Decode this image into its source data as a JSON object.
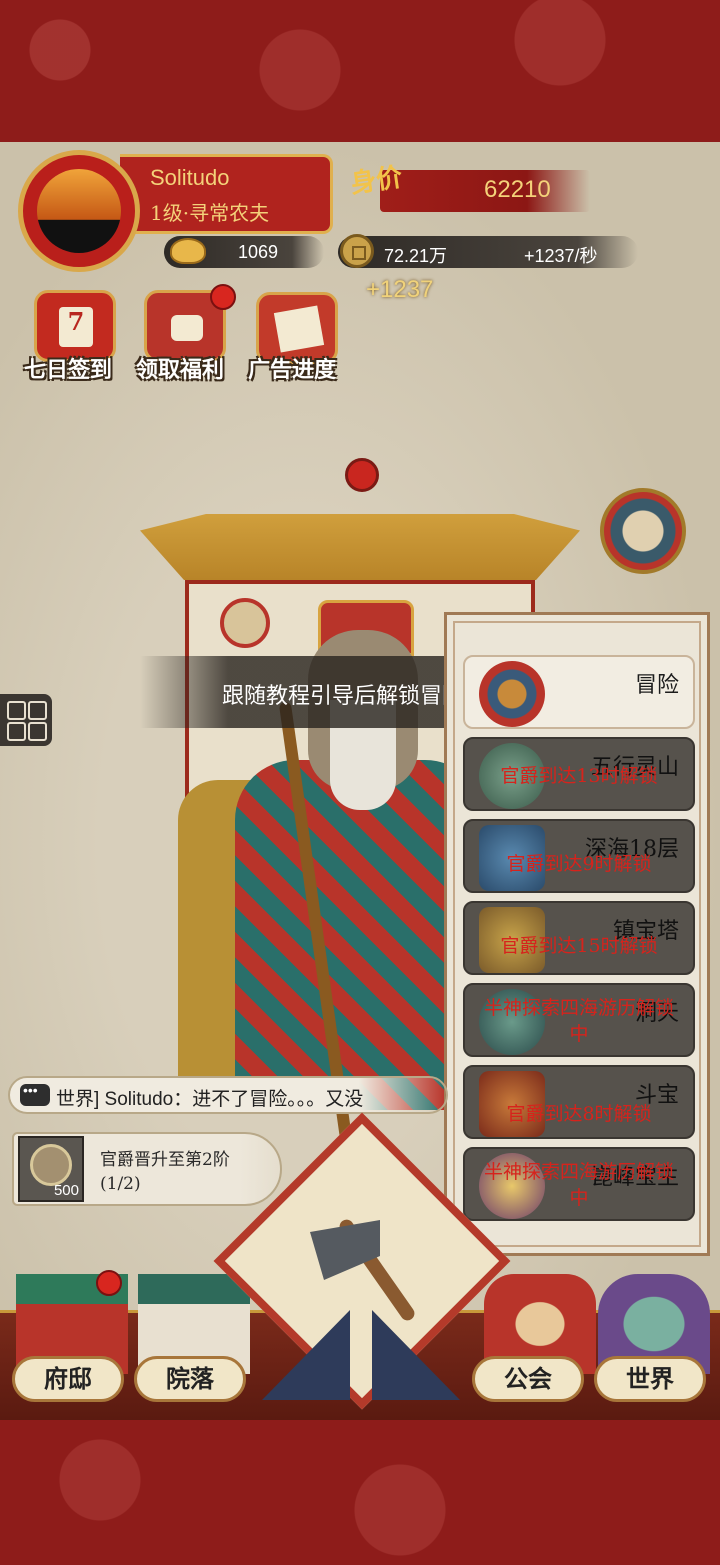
{
  "player": {
    "name": "Solitudo",
    "rank": "1级·寻常农夫",
    "worth_label": "身价",
    "worth": "62210"
  },
  "currency": {
    "ingot": "1069",
    "coins": "72.21万",
    "rate": "+1237/秒",
    "gain_popup": "+1237"
  },
  "top_menu": [
    {
      "label": "七日签到",
      "badge": "7"
    },
    {
      "label": "领取福利"
    },
    {
      "label": "广告进度"
    }
  ],
  "tutorial": "跟随教程引导后解锁冒险",
  "adventure": {
    "items": [
      {
        "title": "冒险",
        "lock": ""
      },
      {
        "title": "五行灵山",
        "lock": "官爵到达13时解锁"
      },
      {
        "title": "深海18层",
        "lock": "官爵到达9时解锁"
      },
      {
        "title": "镇宝塔",
        "lock": "官爵到达15时解锁"
      },
      {
        "title": "洞天",
        "lock": "半神探索四海游历解锁中"
      },
      {
        "title": "斗宝",
        "lock": "官爵到达8时解锁"
      },
      {
        "title": "崑峰宝主",
        "lock": "半神探索四海游历解锁中"
      }
    ]
  },
  "chat": {
    "text": "世界] Solitudo：进不了冒险。。。又没"
  },
  "quest": {
    "line1": "官爵晋升至第2阶",
    "line2": "(1/2)",
    "reward": "500"
  },
  "nav": {
    "mansion": "府邸",
    "courtyard": "院落",
    "guild": "公会",
    "world": "世界"
  },
  "colors": {
    "frame_red": "#8e1c1a",
    "gold": "#f4d27a",
    "lock_red": "#d6231c"
  }
}
